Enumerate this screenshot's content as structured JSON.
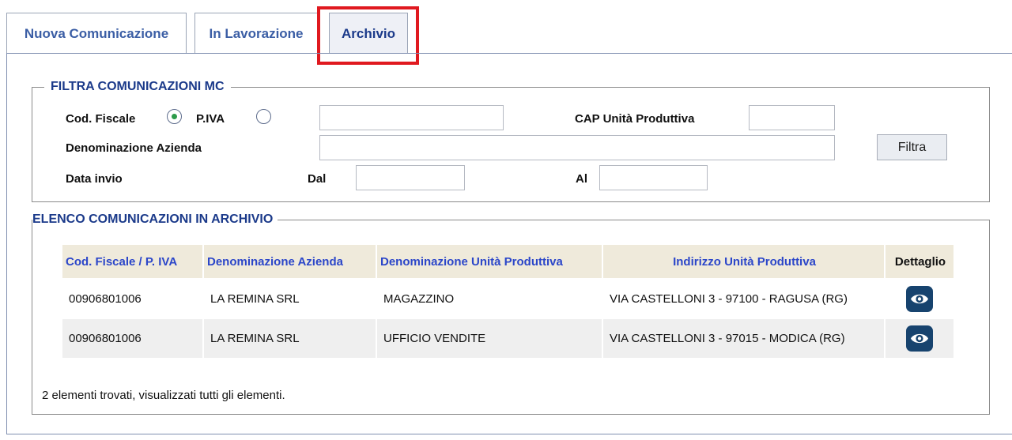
{
  "tabs": [
    {
      "label": "Nuova Comunicazione"
    },
    {
      "label": "In Lavorazione"
    },
    {
      "label": "Archivio",
      "active": true
    }
  ],
  "filter": {
    "legend": "FILTRA COMUNICAZIONI MC",
    "cod_fiscale_label": "Cod. Fiscale",
    "piva_label": "P.IVA",
    "selected_option": "Cod. Fiscale",
    "cf_value": "",
    "cap_label": "CAP Unità Produttiva",
    "cap_value": "",
    "denominazione_label": "Denominazione Azienda",
    "denominazione_value": "",
    "data_invio_label": "Data invio",
    "dal_label": "Dal",
    "dal_value": "",
    "al_label": "Al",
    "al_value": "",
    "button_label": "Filtra"
  },
  "list": {
    "legend": "ELENCO COMUNICAZIONI IN ARCHIVIO",
    "columns": [
      "Cod. Fiscale / P. IVA",
      "Denominazione Azienda",
      "Denominazione Unità Produttiva",
      "Indirizzo Unità Produttiva",
      "Dettaglio"
    ],
    "rows": [
      {
        "cf": "00906801006",
        "azienda": "LA REMINA SRL",
        "unita": "MAGAZZINO",
        "indirizzo": "VIA CASTELLONI 3 - 97100 - RAGUSA (RG)",
        "icon": "eye-icon"
      },
      {
        "cf": "00906801006",
        "azienda": "LA REMINA SRL",
        "unita": "UFFICIO VENDITE",
        "indirizzo": "VIA CASTELLONI 3 - 97015 - MODICA (RG)",
        "icon": "eye-icon"
      }
    ],
    "summary": "2 elementi trovati, visualizzati tutti gli elementi."
  },
  "colors": {
    "tab_text": "#3b5ea5",
    "legend_text": "#1b3a8a",
    "header_text": "#2b46c9",
    "header_bg": "#efeadb",
    "highlight": "#e0191f",
    "eye_button": "#17436e"
  }
}
